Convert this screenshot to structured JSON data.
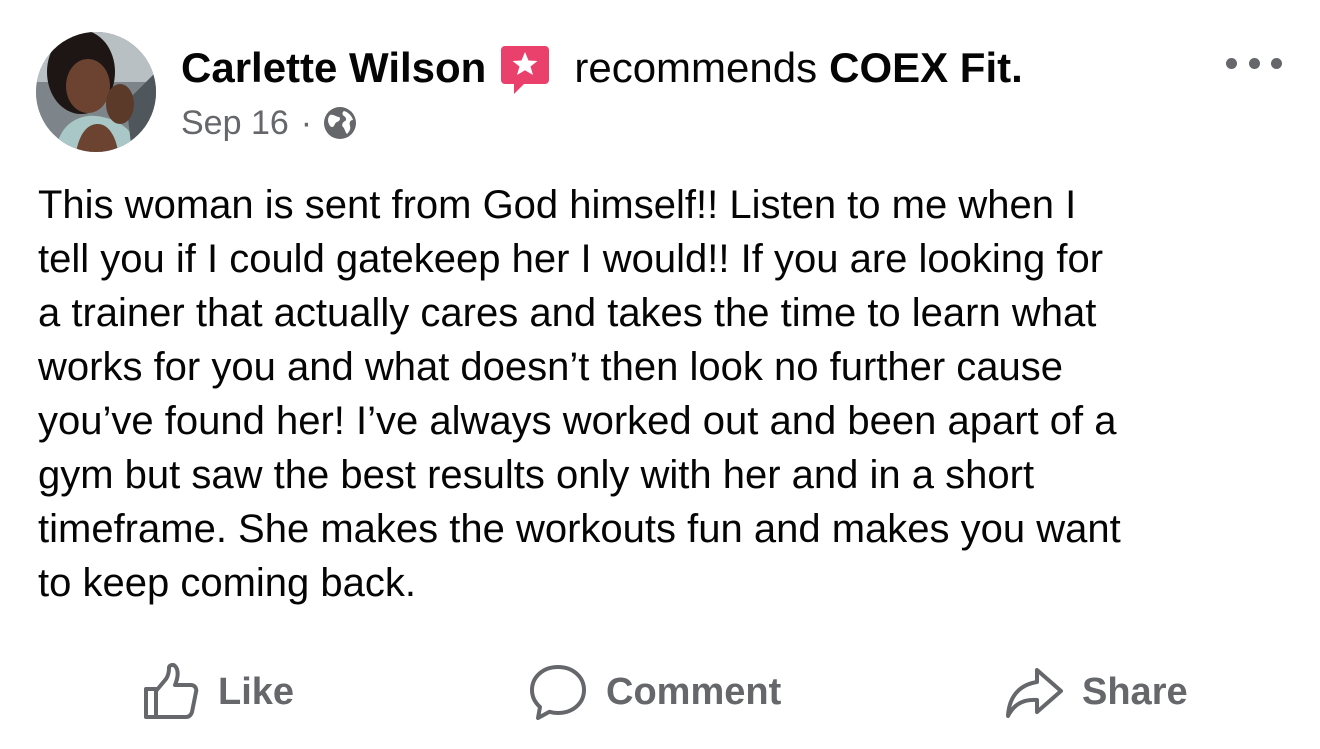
{
  "post": {
    "author": "Carlette Wilson",
    "recommends_text": "recommends",
    "page_name": "COEX Fit.",
    "date": "Sep 16",
    "separator": "·",
    "privacy_icon": "globe-icon",
    "recommendation_icon": "star-speech-bubble-icon",
    "body_lines": [
      "This woman is sent from God himself!! Listen to me when I",
      "tell you if I could gatekeep her I would!! If you are looking for",
      "a trainer that actually cares and takes the time to learn what",
      "works for you and what doesn’t then look no further cause",
      "you’ve found her! I’ve always worked out and been apart of a",
      "gym but saw the best results only with her and in a short",
      "timeframe. She makes the workouts fun and makes you want",
      "to keep coming back."
    ]
  },
  "actions": {
    "like": "Like",
    "comment": "Comment",
    "share": "Share"
  },
  "colors": {
    "text": "#050505",
    "secondary_text": "#65676b",
    "recommend_badge": "#e9416c"
  }
}
